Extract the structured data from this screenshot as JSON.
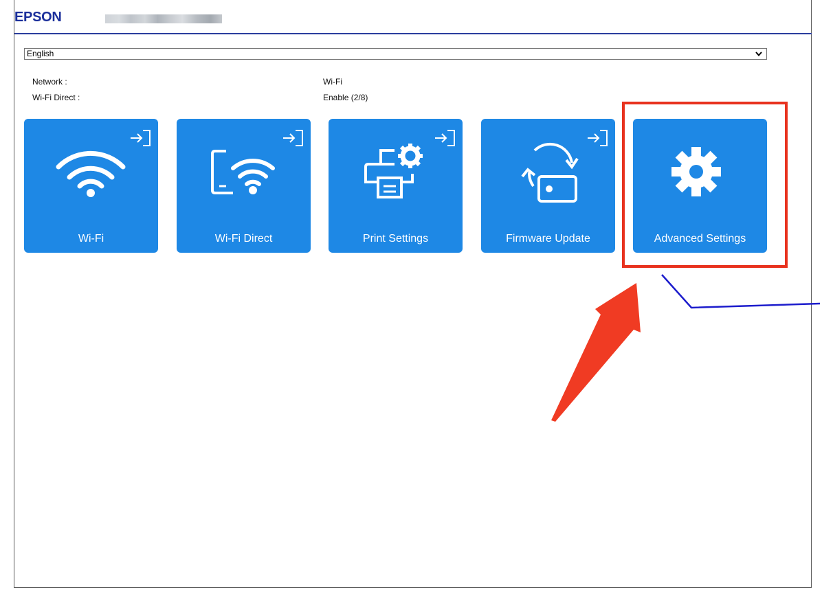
{
  "header": {
    "brand": "EPSON"
  },
  "language": {
    "selected": "English"
  },
  "status": [
    {
      "label": "Network :",
      "value": "Wi-Fi"
    },
    {
      "label": "Wi-Fi Direct :",
      "value": "Enable (2/8)"
    }
  ],
  "tiles": [
    {
      "label": "Wi-Fi",
      "icon": "wifi-icon"
    },
    {
      "label": "Wi-Fi Direct",
      "icon": "wifi-direct-icon"
    },
    {
      "label": "Print Settings",
      "icon": "printer-settings-icon"
    },
    {
      "label": "Firmware Update",
      "icon": "firmware-update-icon"
    },
    {
      "label": "Advanced Settings",
      "icon": "gear-icon"
    }
  ],
  "colors": {
    "brand": "#1b2f9b",
    "tile": "#1e88e5",
    "annotation_highlight": "#e8321e",
    "annotation_line": "#1c1ccc"
  }
}
